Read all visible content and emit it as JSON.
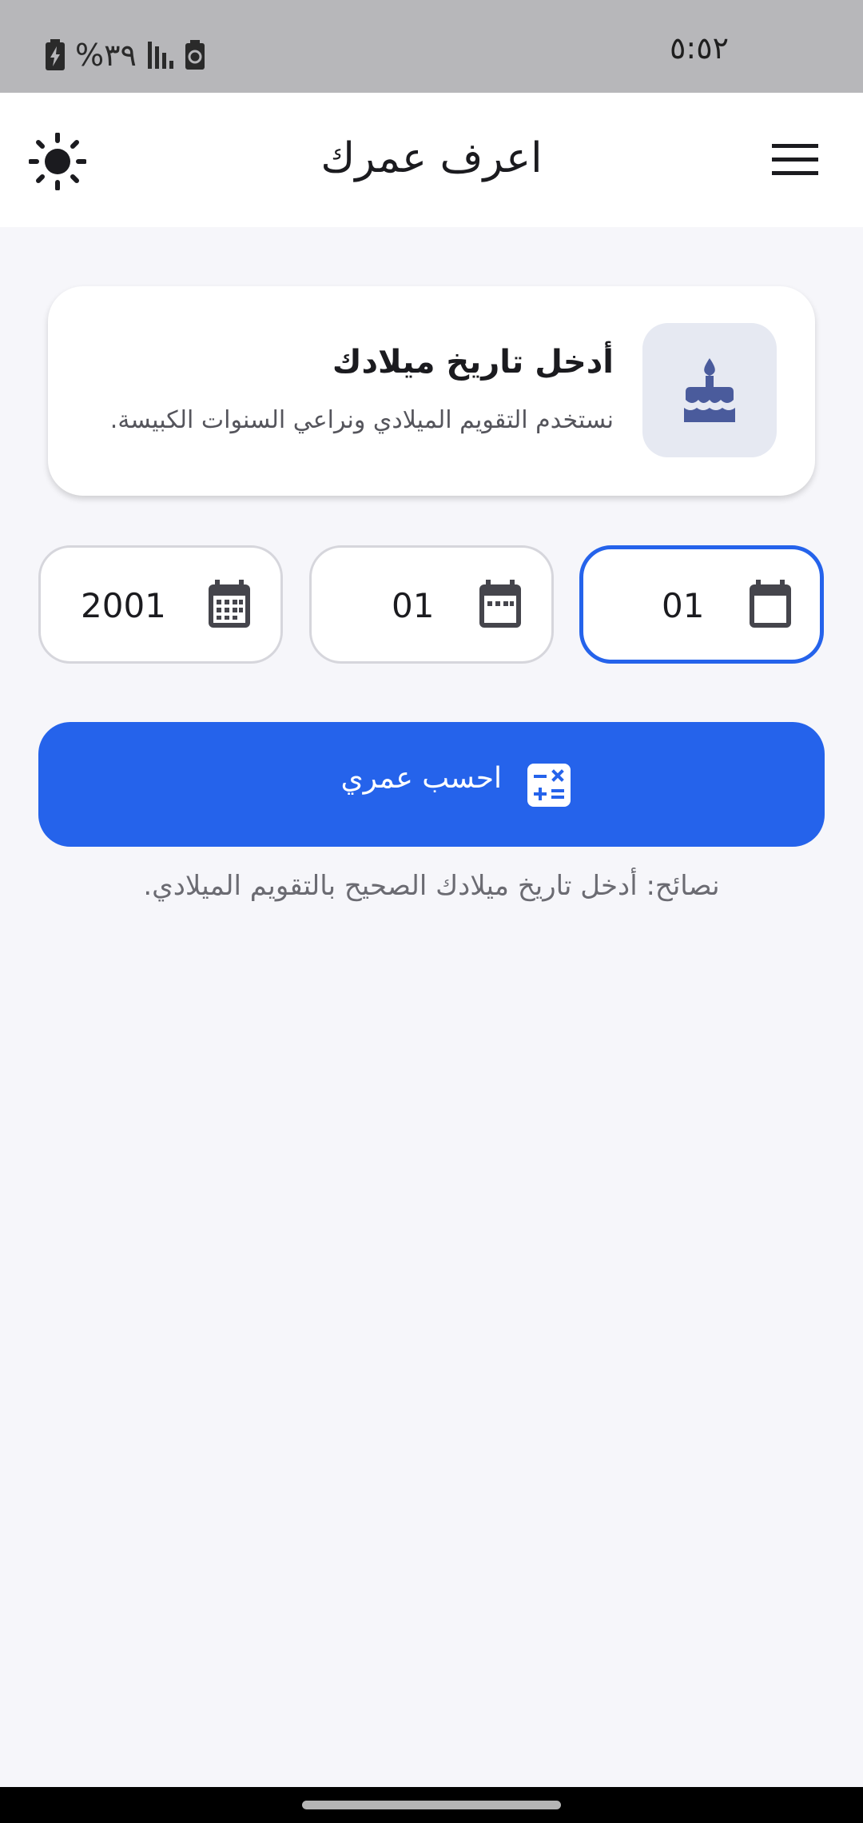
{
  "status_bar": {
    "time": "٥:٥٢",
    "battery": "%٣٩",
    "icons": [
      "battery-charging-icon",
      "signal-icon",
      "recycle-icon"
    ]
  },
  "app_bar": {
    "title": "اعرف عمرك",
    "icons": [
      "theme-toggle-icon",
      "menu-icon"
    ]
  },
  "info_card": {
    "heading": "أدخل تاريخ ميلادك",
    "subtitle": "نستخدم التقويم الميلادي ونراعي السنوات الكبيسة.",
    "icon": "cake-icon"
  },
  "date_fields": {
    "day": "01",
    "month": "01",
    "year": "2001",
    "active_field": "day"
  },
  "calculate_button": {
    "label": "احسب عمري",
    "icon": "calculator-icon"
  },
  "tips": "نصائح: أدخل تاريخ ميلادك الصحيح بالتقويم الميلادي.",
  "colors": {
    "primary": "#2563eb",
    "background": "#f6f6fa",
    "card": "#ffffff",
    "cake_icon": "#4a5b9c",
    "icon_dark": "#45454c"
  }
}
